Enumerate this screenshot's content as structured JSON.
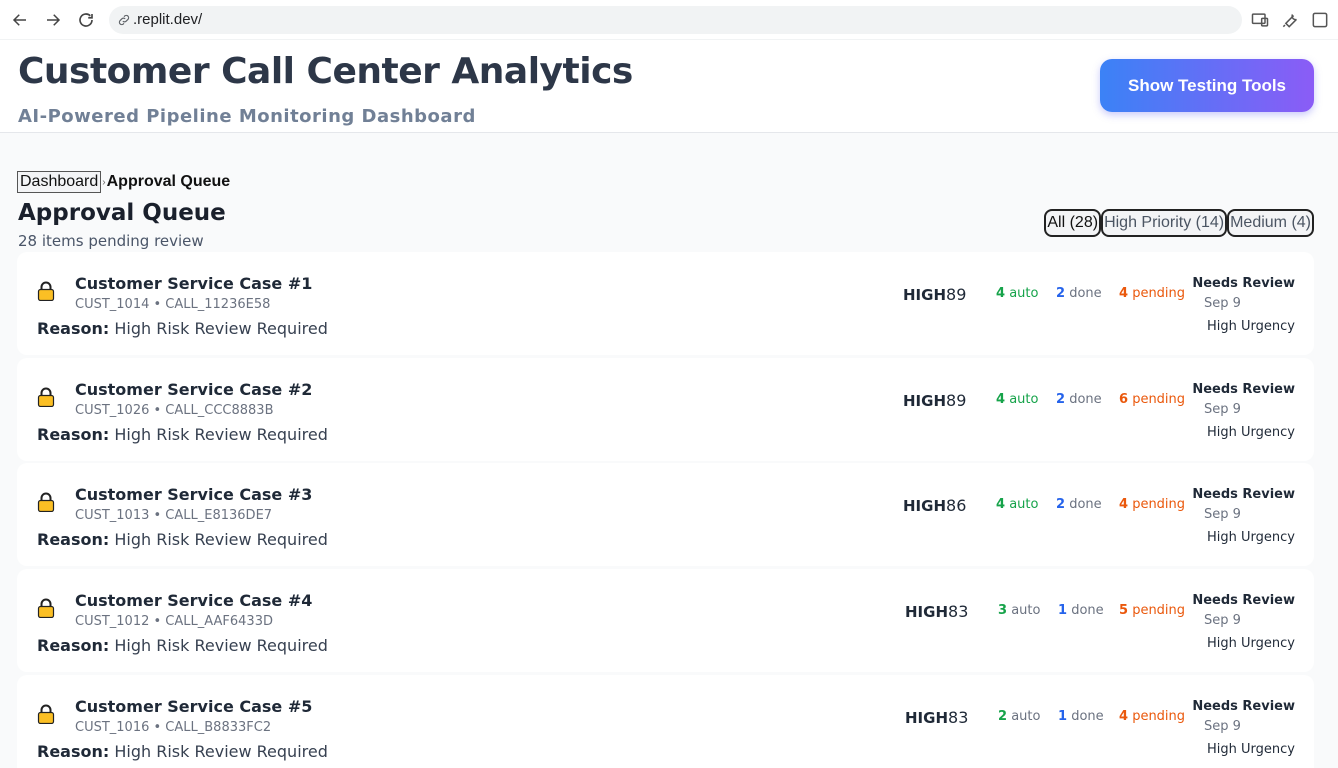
{
  "browser": {
    "url": ".replit.dev/"
  },
  "header": {
    "title": "Customer Call Center Analytics",
    "subtitle": "AI-Powered Pipeline Monitoring Dashboard",
    "testing_button": "Show Testing Tools"
  },
  "breadcrumb": {
    "root": "Dashboard",
    "separator": "›",
    "current": "Approval Queue"
  },
  "queue": {
    "title": "Approval Queue",
    "count_text": "28 items pending review"
  },
  "filters": [
    {
      "label": "All (28)",
      "active": true
    },
    {
      "label": "High Priority (14)",
      "active": false
    },
    {
      "label": "Medium (4)",
      "active": false
    }
  ],
  "cases": [
    {
      "title": "Customer Service Case #1",
      "ids": "CUST_1014 • CALL_11236E58",
      "reason_label": "Reason:",
      "reason": "High Risk Review Required",
      "priority": "HIGH",
      "score": "89",
      "auto": "4",
      "auto_label": "auto",
      "done": "2",
      "done_label": "done",
      "pending": "4",
      "pending_label": "pending",
      "status": "Needs Review",
      "date": "Sep 9",
      "urgency": "High Urgency"
    },
    {
      "title": "Customer Service Case #2",
      "ids": "CUST_1026 • CALL_CCC8883B",
      "reason_label": "Reason:",
      "reason": "High Risk Review Required",
      "priority": "HIGH",
      "score": "89",
      "auto": "4",
      "auto_label": "auto",
      "done": "2",
      "done_label": "done",
      "pending": "6",
      "pending_label": "pending",
      "status": "Needs Review",
      "date": "Sep 9",
      "urgency": "High Urgency"
    },
    {
      "title": "Customer Service Case #3",
      "ids": "CUST_1013 • CALL_E8136DE7",
      "reason_label": "Reason:",
      "reason": "High Risk Review Required",
      "priority": "HIGH",
      "score": "86",
      "auto": "4",
      "auto_label": "auto",
      "done": "2",
      "done_label": "done",
      "pending": "4",
      "pending_label": "pending",
      "status": "Needs Review",
      "date": "Sep 9",
      "urgency": "High Urgency"
    },
    {
      "title": "Customer Service Case #4",
      "ids": "CUST_1012 • CALL_AAF6433D",
      "reason_label": "Reason:",
      "reason": "High Risk Review Required",
      "priority": "HIGH",
      "score": "83",
      "auto": "3",
      "auto_label": "auto",
      "done": "1",
      "done_label": "done",
      "pending": "5",
      "pending_label": "pending",
      "status": "Needs Review",
      "date": "Sep 9",
      "urgency": "High Urgency"
    },
    {
      "title": "Customer Service Case #5",
      "ids": "CUST_1016 • CALL_B8833FC2",
      "reason_label": "Reason:",
      "reason": "High Risk Review Required",
      "priority": "HIGH",
      "score": "83",
      "auto": "2",
      "auto_label": "auto",
      "done": "1",
      "done_label": "done",
      "pending": "4",
      "pending_label": "pending",
      "status": "Needs Review",
      "date": "Sep 9",
      "urgency": "High Urgency"
    }
  ],
  "colors": {
    "auto": "#16a34a",
    "done": "#2563eb",
    "pending": "#ea580c",
    "lock": "#fbbf24"
  }
}
